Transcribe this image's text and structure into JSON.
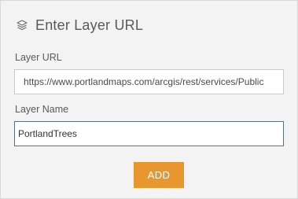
{
  "header": {
    "icon": "layers-icon",
    "title": "Enter Layer URL"
  },
  "layer_url": {
    "label": "Layer URL",
    "value": "https://www.portlandmaps.com/arcgis/rest/services/Public"
  },
  "layer_name": {
    "label": "Layer Name",
    "value": "PortlandTrees"
  },
  "actions": {
    "add_label": "ADD"
  },
  "colors": {
    "accent": "#e8962e",
    "panel_background": "#f3f3f3",
    "text": "#5a5a5a",
    "focused_border": "#5b6f85"
  }
}
